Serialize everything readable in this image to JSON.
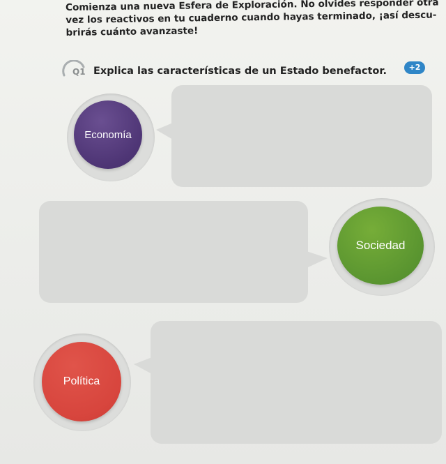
{
  "instructions": {
    "line1": "Comienza una nueva Esfera de Exploración. No olvides responder otra",
    "line2": "vez los reactivos en tu cuaderno cuando hayas terminado, ¡así descu-",
    "line3": "brirás cuánto avanzaste!"
  },
  "question": {
    "number": "Q1",
    "text": "Explica las características de un Estado benefactor.",
    "badge": "+2"
  },
  "topics": [
    {
      "label": "Economía",
      "color": "#5a3d7f"
    },
    {
      "label": "Sociedad",
      "color": "#5f9a30"
    },
    {
      "label": "Política",
      "color": "#d94a40"
    }
  ],
  "colors": {
    "answer_box": "#d9dad8",
    "badge": "#2f86c7"
  }
}
